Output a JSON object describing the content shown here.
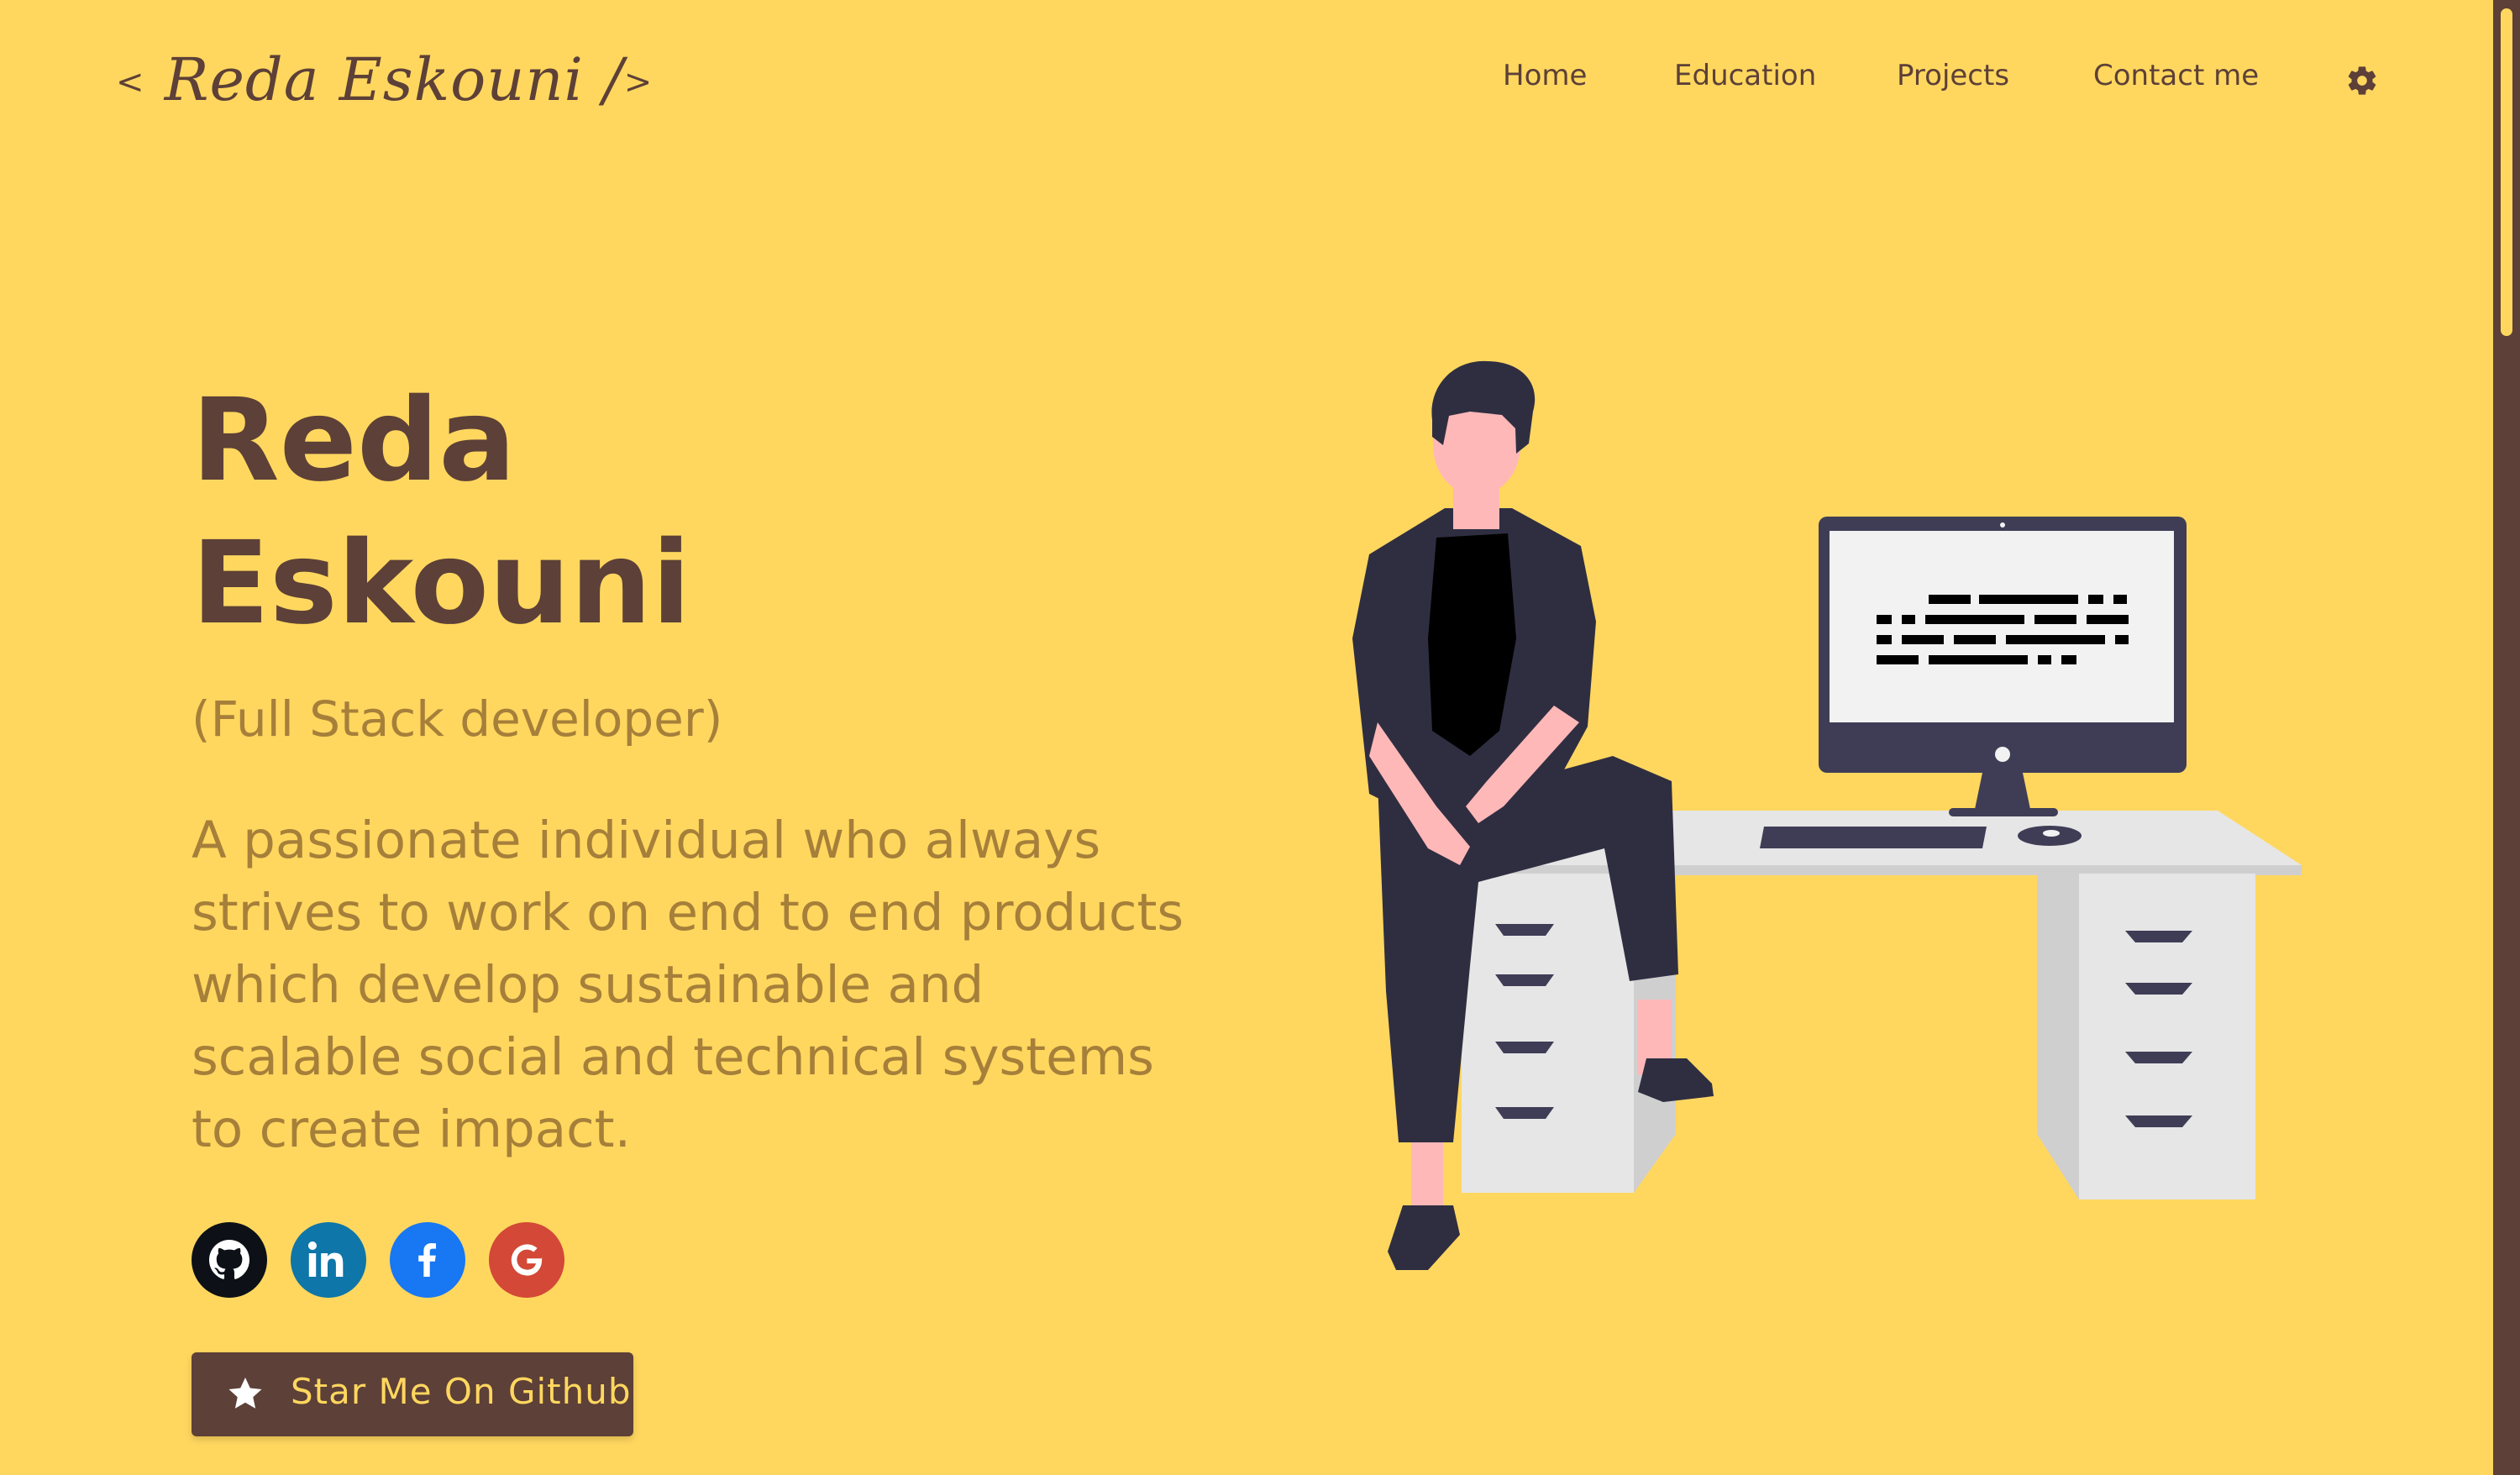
{
  "header": {
    "logo_open": "<",
    "logo_text": "Reda Eskouni /",
    "logo_close": ">",
    "nav": [
      {
        "label": "Home"
      },
      {
        "label": "Education"
      },
      {
        "label": "Projects"
      },
      {
        "label": "Contact me"
      }
    ],
    "theme_icon": "gear-icon"
  },
  "hero": {
    "name_line1": "Reda",
    "name_line2": "Eskouni",
    "subtitle": "(Full Stack developer)",
    "bio": "A passionate individual who always strives to work on end to end products which develop sustainable and scalable social and technical systems to create impact.",
    "social": [
      {
        "name": "github-icon",
        "color": "#0D1117"
      },
      {
        "name": "linkedin-icon",
        "color": "#0E76A8"
      },
      {
        "name": "facebook-icon",
        "color": "#1877F2"
      },
      {
        "name": "google-icon",
        "color": "#D34836"
      }
    ],
    "star_button_label": "Star Me On Github",
    "star_icon": "star-icon"
  },
  "colors": {
    "background": "#FFD75F",
    "primary_text": "#5D4037",
    "secondary_text": "#A67F3A",
    "button_bg": "#5D4037",
    "button_text": "#FFD75F"
  }
}
